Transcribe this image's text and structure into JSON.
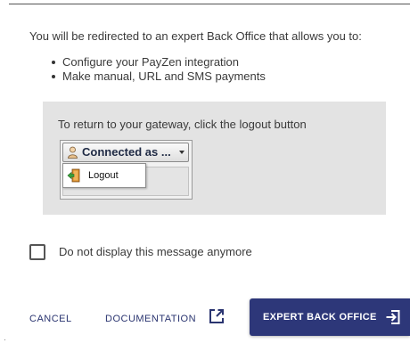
{
  "dialog": {
    "intro": "You will be redirected to an expert Back Office that allows you to:",
    "bullets": [
      "Configure your PayZen integration",
      "Make manual, URL and SMS payments"
    ]
  },
  "panel": {
    "text": "To return to your gateway, click the logout button",
    "mock": {
      "connected_label": "Connected as ...",
      "menu_item": "Logout"
    }
  },
  "checkbox": {
    "label": "Do not display this message anymore",
    "checked": false
  },
  "footer": {
    "cancel_label": "CANCEL",
    "documentation_label": "DOCUMENTATION",
    "primary_label": "EXPERT BACK OFFICE"
  },
  "colors": {
    "primary": "#2d3779",
    "panel_bg": "#e3e3e3",
    "text": "#3a3a3a"
  },
  "icons": {
    "documentation": "external-link-icon",
    "primary": "login-icon",
    "mock_user": "user-icon",
    "mock_logout": "logout-door-icon"
  }
}
